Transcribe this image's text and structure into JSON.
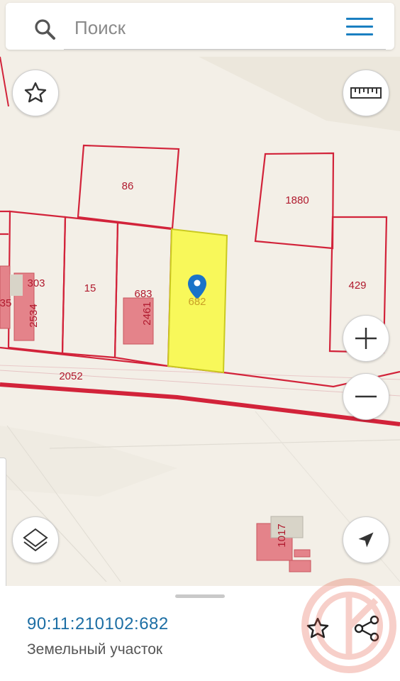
{
  "search": {
    "placeholder": "Поиск"
  },
  "map": {
    "parcels": [
      {
        "id": "86",
        "label": "86"
      },
      {
        "id": "1880",
        "label": "1880"
      },
      {
        "id": "303",
        "label": "303"
      },
      {
        "id": "15",
        "label": "15"
      },
      {
        "id": "683",
        "label": "683"
      },
      {
        "id": "682",
        "label": "682",
        "selected": true
      },
      {
        "id": "429",
        "label": "429"
      },
      {
        "id": "2052",
        "label": "2052"
      }
    ],
    "buildings": [
      {
        "label": "2534"
      },
      {
        "label": "2461"
      },
      {
        "label": "1017"
      }
    ],
    "edge_label": "35",
    "colors": {
      "boundary": "#d2233a",
      "selected_fill": "#f8f85a",
      "marker": "#1a73c8",
      "background": "#f3efe7"
    }
  },
  "controls": {
    "favorite_icon": "star-icon",
    "ruler_icon": "ruler-icon",
    "zoom_in_icon": "plus-icon",
    "zoom_out_icon": "minus-icon",
    "layers_icon": "layers-icon",
    "location_icon": "navigation-arrow-icon"
  },
  "panel": {
    "cadastral_number": "90:11:210102:682",
    "object_type": "Земельный участок"
  }
}
